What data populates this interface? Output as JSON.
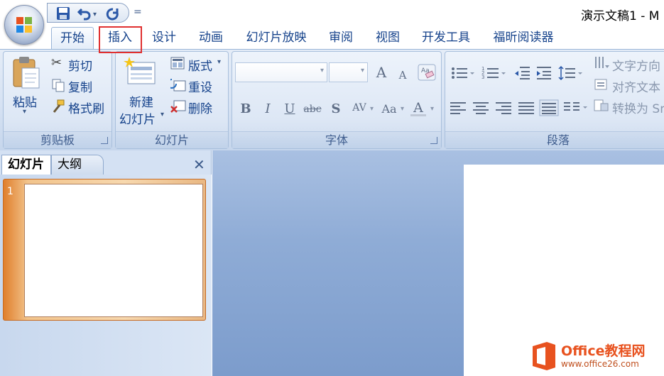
{
  "window": {
    "title": "演示文稿1 - M"
  },
  "qat": {
    "save_icon": "save-icon",
    "undo_icon": "undo-icon",
    "redo_icon": "redo-icon",
    "customize_glyph": "="
  },
  "tabs": [
    {
      "label": "开始",
      "active": true
    },
    {
      "label": "插入",
      "highlighted": true
    },
    {
      "label": "设计"
    },
    {
      "label": "动画"
    },
    {
      "label": "幻灯片放映"
    },
    {
      "label": "审阅"
    },
    {
      "label": "视图"
    },
    {
      "label": "开发工具"
    },
    {
      "label": "福昕阅读器"
    }
  ],
  "clipboard": {
    "paste": "粘贴",
    "cut": "剪切",
    "copy": "复制",
    "format_painter": "格式刷",
    "group": "剪贴板"
  },
  "slides": {
    "new_slide_1": "新建",
    "new_slide_2": "幻灯片",
    "layout": "版式",
    "reset": "重设",
    "delete": "删除",
    "group": "幻灯片"
  },
  "font": {
    "group": "字体",
    "bold": "B",
    "italic": "I",
    "underline": "U",
    "strike": "abc",
    "shadow": "S",
    "spacing": "AV",
    "case": "Aa",
    "color": "A",
    "grow": "A",
    "shrink": "A"
  },
  "paragraph": {
    "group": "段落",
    "text_direction": "文字方向",
    "align_text": "对齐文本",
    "convert": "转换为 Sm"
  },
  "pane": {
    "tab_slides": "幻灯片",
    "tab_outline": "大纲",
    "close": "✕",
    "slide_number": "1"
  },
  "watermark": {
    "brand": "Office教程网",
    "url": "www.office26.com"
  },
  "colors": {
    "accent": "#15428b",
    "highlight_border": "#e03030",
    "brand_orange": "#e8521f"
  }
}
